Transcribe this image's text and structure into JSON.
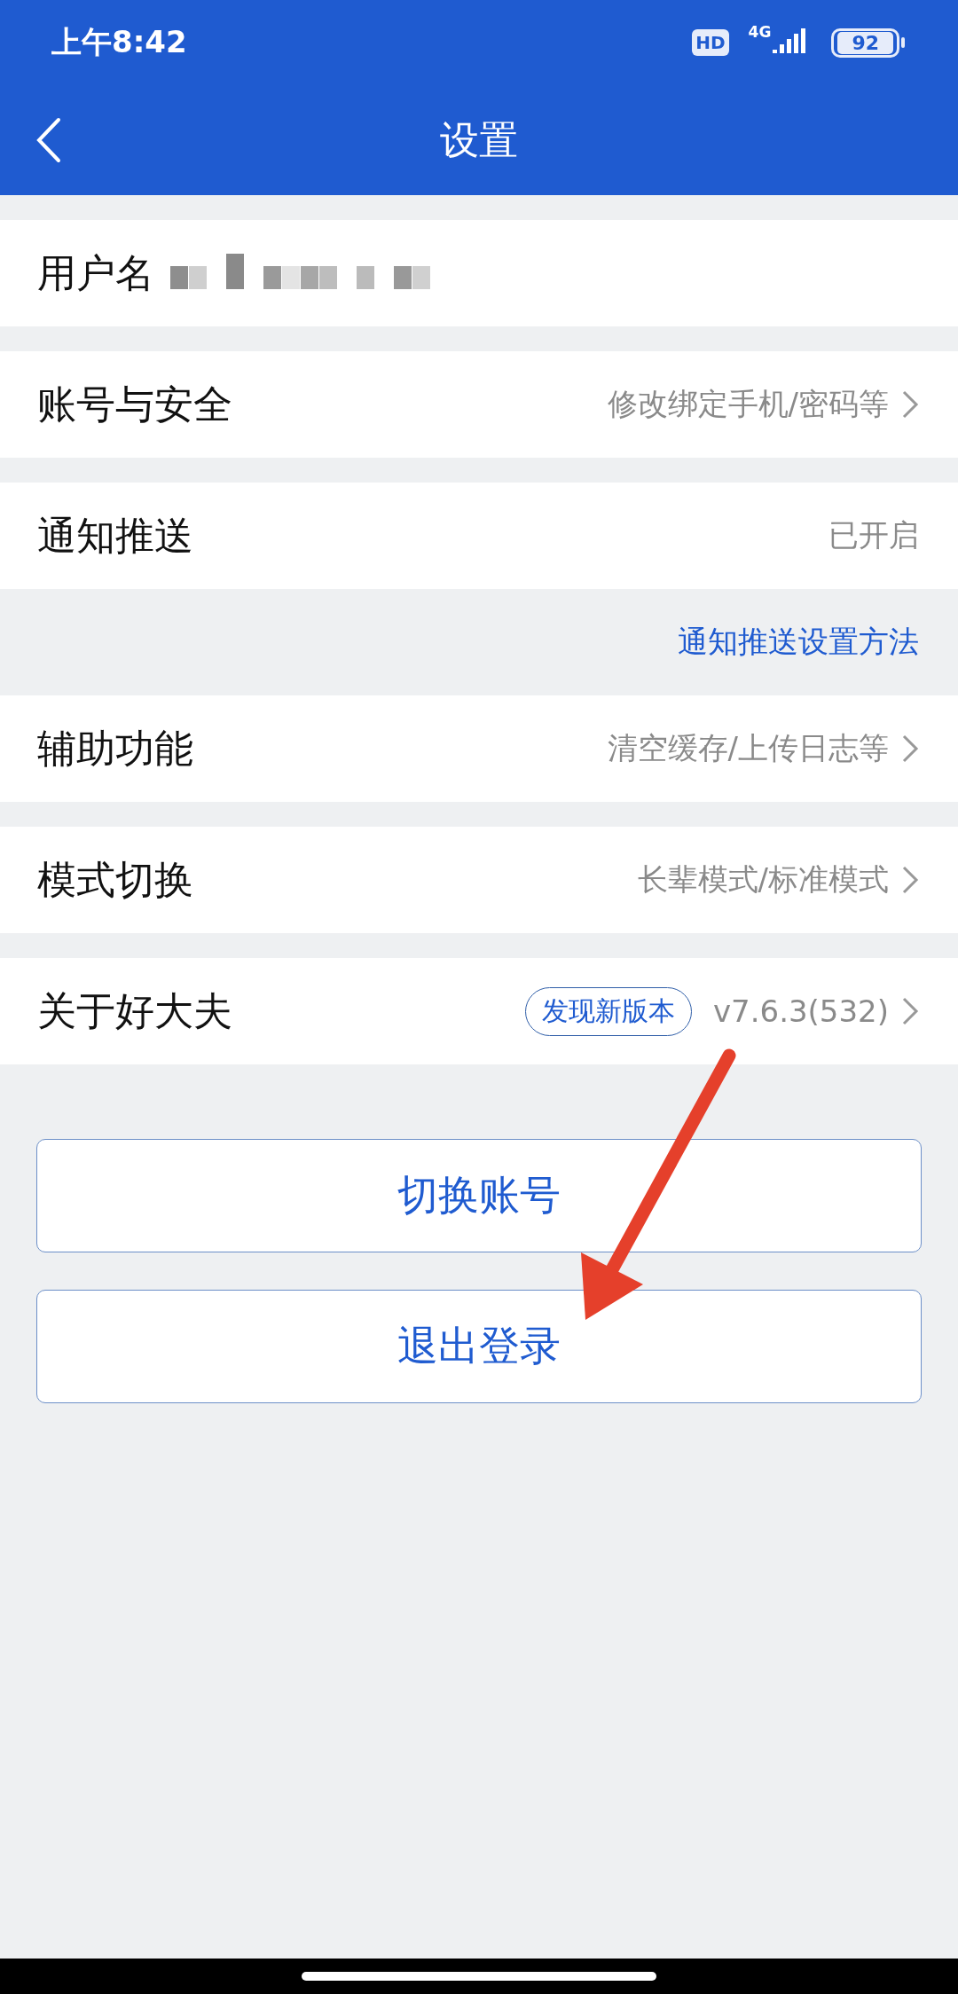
{
  "status_bar": {
    "time": "上午8:42",
    "hd": "HD",
    "network": "4G",
    "battery": "92"
  },
  "header": {
    "title": "设置"
  },
  "rows": [
    {
      "kind": "username",
      "label": "用户名"
    },
    {
      "kind": "nav",
      "label": "账号与安全",
      "value": "修改绑定手机/密码等",
      "chevron": true
    },
    {
      "kind": "nav",
      "label": "通知推送",
      "value": "已开启",
      "chevron": false,
      "link": "通知推送设置方法"
    },
    {
      "kind": "nav",
      "label": "辅助功能",
      "value": "清空缓存/上传日志等",
      "chevron": true
    },
    {
      "kind": "nav",
      "label": "模式切换",
      "value": "长辈模式/标准模式",
      "chevron": true
    },
    {
      "kind": "nav",
      "label": "关于好大夫",
      "badge": "发现新版本",
      "value": "v7.6.3(532)",
      "chevron": true
    }
  ],
  "buttons": [
    "切换账号",
    "退出登录"
  ]
}
